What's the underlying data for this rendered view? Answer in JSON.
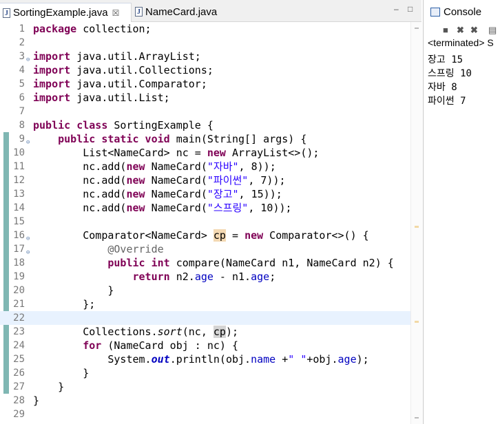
{
  "editor": {
    "tabs": [
      {
        "label": "SortingExample.java",
        "close": "☒"
      },
      {
        "label": "NameCard.java"
      }
    ],
    "minimize": "–",
    "maximize": "□"
  },
  "code": {
    "line_numbers": [
      "1",
      "2",
      "3",
      "4",
      "5",
      "6",
      "7",
      "8",
      "9",
      "10",
      "11",
      "12",
      "13",
      "14",
      "15",
      "16",
      "17",
      "18",
      "19",
      "20",
      "21",
      "22",
      "23",
      "24",
      "25",
      "26",
      "27",
      "28",
      "29"
    ],
    "s_jaba": "\"자바\"",
    "s_python": "\"파이썬\"",
    "s_jango": "\"장고\"",
    "s_spring": "\"스프링\"",
    "s_space": "\" \""
  },
  "console": {
    "title": "Console",
    "status": "<terminated> S",
    "output": [
      "장고 15",
      "스프링 10",
      "자바 8",
      "파이썬 7"
    ]
  }
}
